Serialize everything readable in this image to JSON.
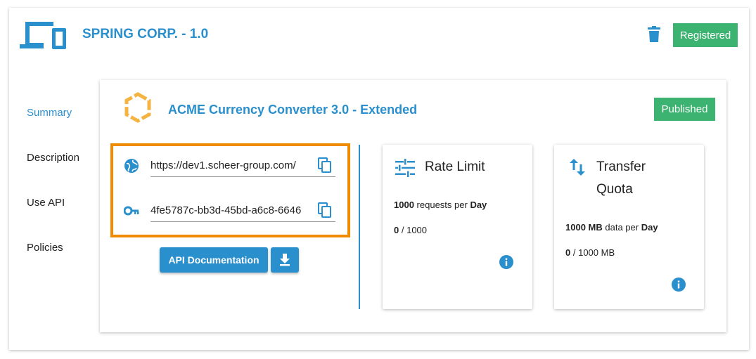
{
  "header": {
    "app_title": "SPRING CORP. - 1.0",
    "status_badge": "Registered",
    "icons": {
      "app": "devices-icon",
      "delete": "trash-icon"
    }
  },
  "sidebar": {
    "items": [
      {
        "label": "Summary",
        "active": true
      },
      {
        "label": "Description",
        "active": false
      },
      {
        "label": "Use API",
        "active": false
      },
      {
        "label": "Policies",
        "active": false
      }
    ]
  },
  "api": {
    "title": "ACME Currency Converter 3.0 - Extended",
    "status_badge": "Published",
    "endpoint_url": "https://dev1.scheer-group.com/",
    "api_key": "4fe5787c-bb3d-45bd-a6c8-6646",
    "doc_button": "API Documentation",
    "icons": {
      "url": "globe-icon",
      "key": "key-icon",
      "copy": "copy-icon",
      "download": "download-icon"
    }
  },
  "rate_limit": {
    "title": "Rate Limit",
    "amount": "1000",
    "unit_text": "requests per",
    "period": "Day",
    "used": "0",
    "total": "/ 1000"
  },
  "transfer_quota": {
    "title_line1": "Transfer",
    "title_line2": "Quota",
    "amount": "1000 MB",
    "unit_text": "data per",
    "period": "Day",
    "used": "0",
    "total": "/ 1000 MB"
  },
  "colors": {
    "accent": "#2a8fcd",
    "success": "#3cb371",
    "highlight": "#f08a00",
    "logo": "#f5b342"
  }
}
